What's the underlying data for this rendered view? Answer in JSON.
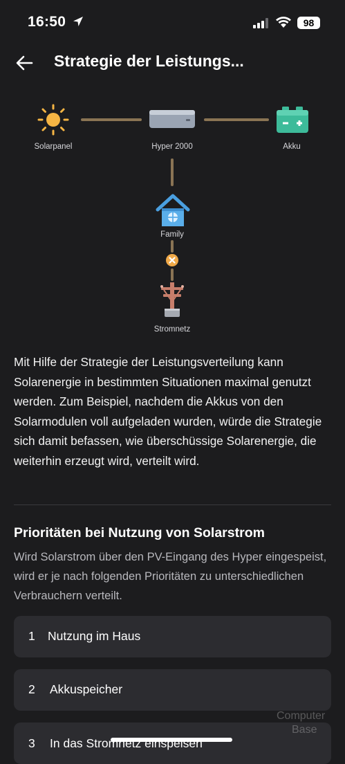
{
  "status_bar": {
    "time": "16:50",
    "battery": "98"
  },
  "header": {
    "title": "Strategie der Leistungs..."
  },
  "diagram": {
    "solar_label": "Solarpanel",
    "hyper_label": "Hyper 2000",
    "battery_label": "Akku",
    "home_label": "Family",
    "grid_label": "Stromnetz"
  },
  "description": "Mit Hilfe der Strategie der Leistungsverteilung kann Solarenergie in bestimmten Situationen maximal genutzt werden. Zum Beispiel, nachdem die Akkus von den Solarmodulen voll aufgeladen wurden, würde die Strategie sich damit befassen, wie überschüssige Solarenergie, die weiterhin erzeugt wird, verteilt wird.",
  "section": {
    "title": "Prioritäten bei Nutzung von Solarstrom",
    "text": "Wird Solarstrom über den PV-Eingang des Hyper eingespeist, wird er je nach folgenden Prioritäten zu unterschiedlichen Verbrauchern verteilt."
  },
  "priorities": [
    {
      "number": "1",
      "label": "Nutzung im Haus"
    },
    {
      "number": "2",
      "label": "Akkuspeicher"
    },
    {
      "number": "3",
      "label": "In das Stromnetz einspeisen"
    }
  ],
  "watermark": {
    "line1": "Computer",
    "line2": "Base"
  },
  "colors": {
    "background": "#1c1c1e",
    "card": "#2c2c30",
    "connector": "#8a7454",
    "sun": "#f5b544",
    "battery_icon": "#3dbb9a",
    "house": "#4a9fe0",
    "blocked": "#f0a948"
  }
}
